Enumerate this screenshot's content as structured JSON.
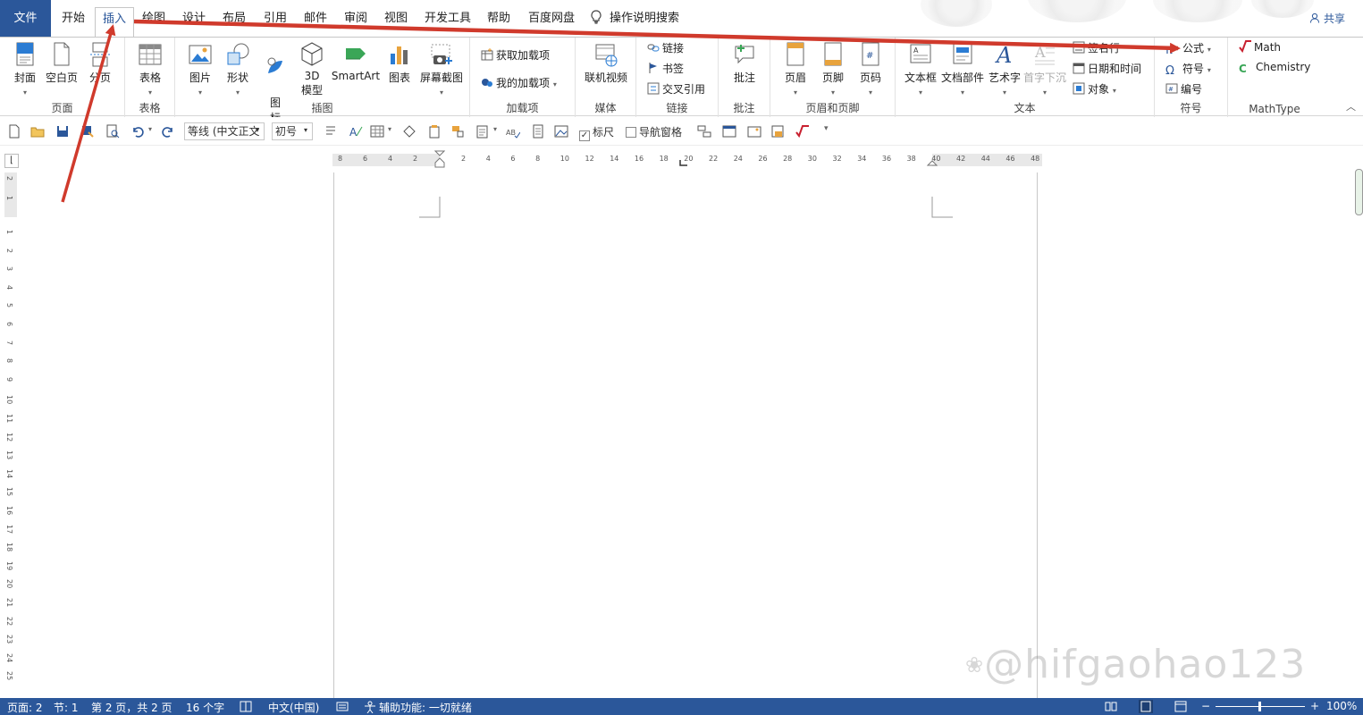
{
  "tabs": {
    "file": "文件",
    "home": "开始",
    "insert": "插入",
    "draw": "绘图",
    "design": "设计",
    "layout": "布局",
    "references": "引用",
    "mailings": "邮件",
    "review": "审阅",
    "view": "视图",
    "developer": "开发工具",
    "help": "帮助",
    "baidu": "百度网盘",
    "tell_me": "操作说明搜索",
    "share": "共享"
  },
  "ribbon": {
    "pages": {
      "label": "页面",
      "cover": "封面",
      "blank": "空白页",
      "break": "分页"
    },
    "tables": {
      "label": "表格",
      "table": "表格"
    },
    "illustrations": {
      "label": "插图",
      "picture": "图片",
      "shapes": "形状",
      "icons": "图\n标",
      "model3d_1": "3D",
      "model3d_2": "模型",
      "smartart": "SmartArt",
      "chart": "图表",
      "screenshot": "屏幕截图"
    },
    "addins": {
      "label": "加载项",
      "get": "获取加载项",
      "my": "我的加载项"
    },
    "media": {
      "label": "媒体",
      "video": "联机视频"
    },
    "links": {
      "label": "链接",
      "link": "链接",
      "bookmark": "书签",
      "crossref": "交叉引用"
    },
    "comments": {
      "label": "批注",
      "comment": "批注"
    },
    "header_footer": {
      "label": "页眉和页脚",
      "header": "页眉",
      "footer": "页脚",
      "page_number": "页码"
    },
    "text": {
      "label": "文本",
      "textbox": "文本框",
      "quickparts": "文档部件",
      "wordart": "艺术字",
      "dropcap": "首字下沉",
      "signature": "签名行",
      "datetime": "日期和时间",
      "object": "对象"
    },
    "symbols": {
      "label": "符号",
      "equation": "公式",
      "symbol": "符号",
      "number": "编号"
    },
    "mathtype": {
      "label": "MathType",
      "math": "Math",
      "chemistry": "Chemistry"
    }
  },
  "qat": {
    "font": "等线 (中文正文",
    "size": "初号",
    "ruler": "标尺",
    "nav_pane": "导航窗格"
  },
  "ruler": {
    "h_left": [
      "8",
      "6",
      "4",
      "2"
    ],
    "h_right": [
      "2",
      "4",
      "6",
      "8",
      "10",
      "12",
      "14",
      "16",
      "18",
      "20",
      "22",
      "24",
      "26",
      "28",
      "30",
      "32",
      "34",
      "36",
      "38",
      "40",
      "42",
      "44",
      "46",
      "48"
    ],
    "v_top": [
      "2",
      "1"
    ],
    "v_main": [
      "1",
      "2",
      "3",
      "4",
      "5",
      "6",
      "7",
      "8",
      "9",
      "10",
      "11",
      "12",
      "13",
      "14",
      "15",
      "16",
      "17",
      "18",
      "19",
      "20",
      "21",
      "22",
      "23",
      "24",
      "25"
    ]
  },
  "status": {
    "page": "页面: 2",
    "section": "节: 1",
    "page_of": "第 2 页，共 2 页",
    "words": "16 个字",
    "language": "中文(中国)",
    "accessibility": "辅助功能: 一切就绪",
    "zoom": "100%",
    "zoom_minus": "−",
    "zoom_plus": "+"
  },
  "watermark": "@hifgaohao123",
  "colors": {
    "accent": "#2b579a",
    "arrow": "#d03a2c"
  }
}
